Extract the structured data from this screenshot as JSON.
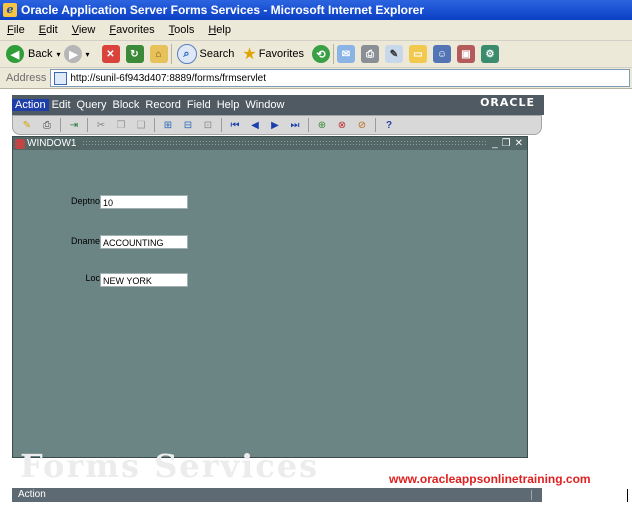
{
  "window": {
    "title": "Oracle Application Server Forms Services - Microsoft Internet Explorer"
  },
  "ie_menu": [
    "File",
    "Edit",
    "View",
    "Favorites",
    "Tools",
    "Help"
  ],
  "ie_toolbar": {
    "back": "Back",
    "search": "Search",
    "favorites": "Favorites"
  },
  "address": {
    "label": "Address",
    "url": "http://sunil-6f943d407:8889/forms/frmservlet"
  },
  "forms_menu": [
    "Action",
    "Edit",
    "Query",
    "Block",
    "Record",
    "Field",
    "Help",
    "Window"
  ],
  "oracle_logo": "ORACLE",
  "window1": {
    "title": "WINDOW1",
    "fields": [
      {
        "label": "Deptno",
        "value": "10"
      },
      {
        "label": "Dname",
        "value": "ACCOUNTING"
      },
      {
        "label": "Loc",
        "value": "NEW YORK"
      }
    ]
  },
  "background_text": "Forms Services",
  "watermark": "www.oracleappsonlinetraining.com",
  "status": {
    "text": "Action"
  },
  "colors": {
    "titlebar": "#0a3fc4",
    "forms_canvas": "#6b8584",
    "watermark": "#e02020"
  }
}
